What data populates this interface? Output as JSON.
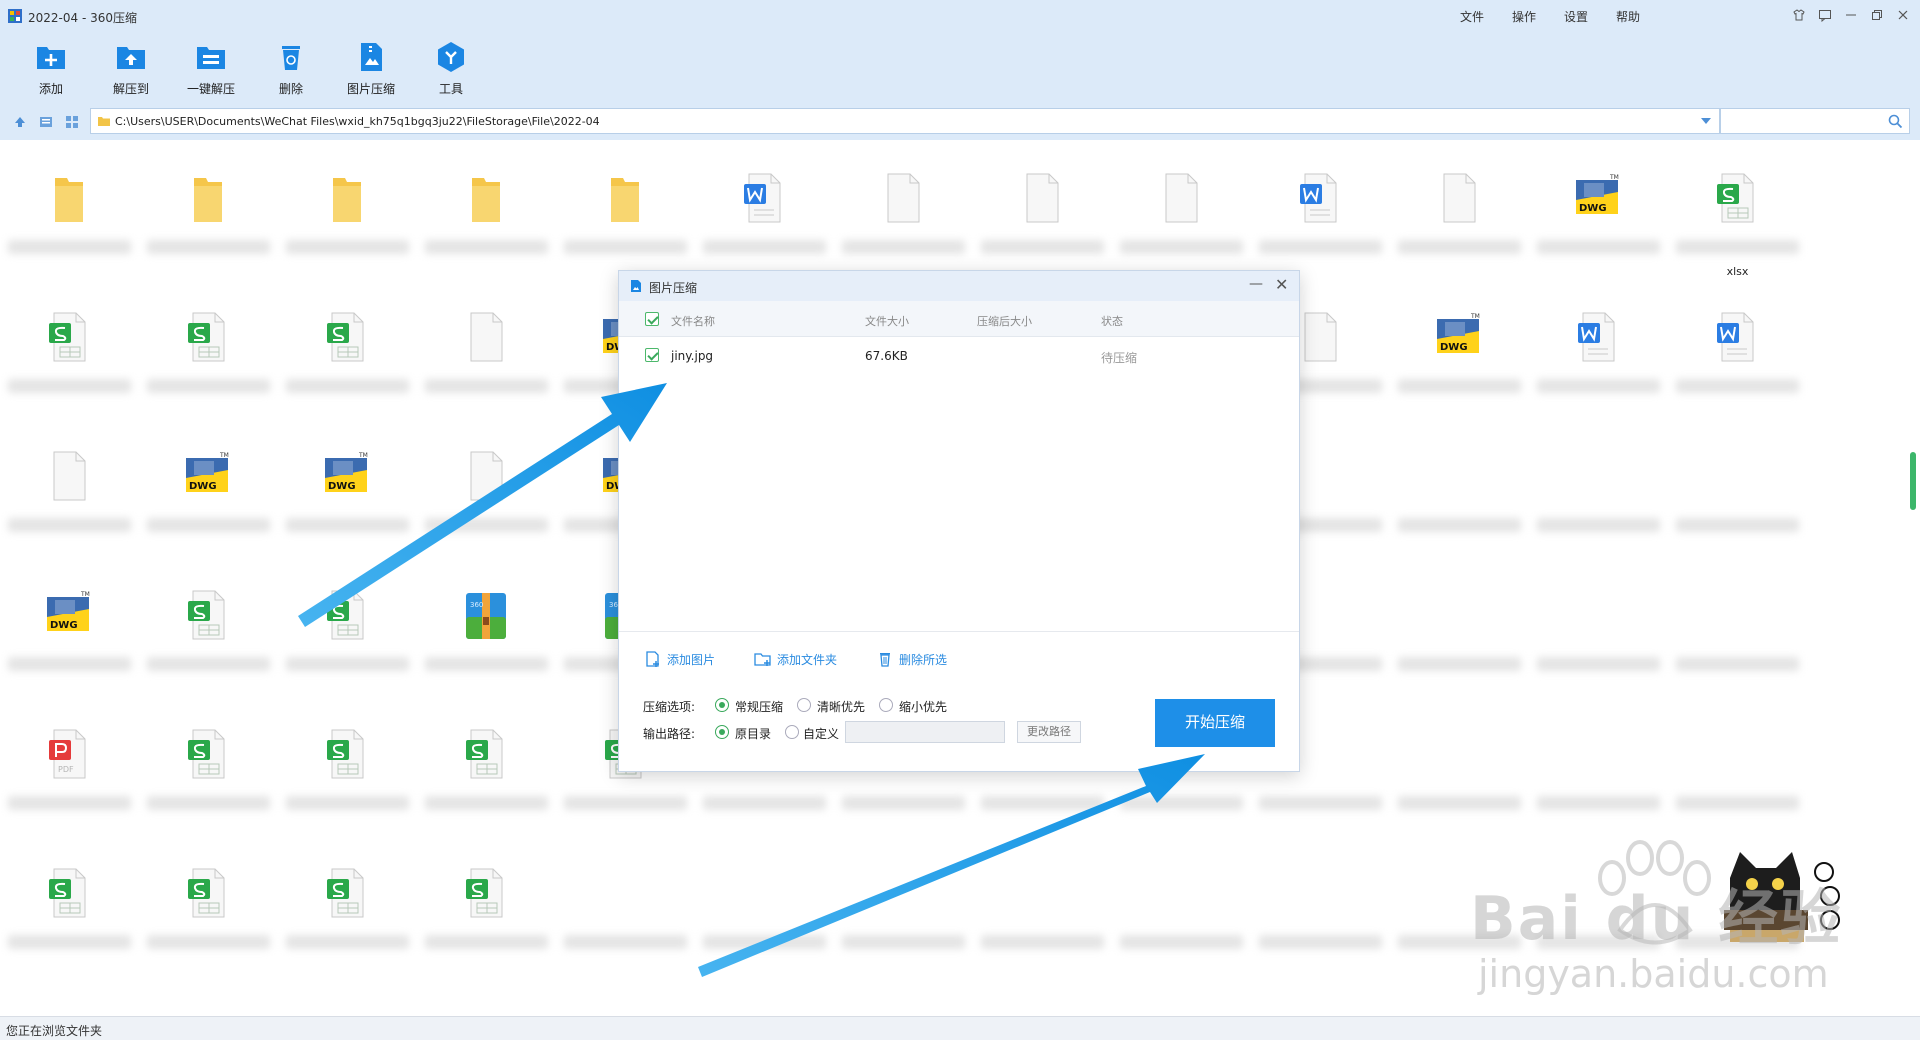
{
  "window": {
    "title": "2022-04 - 360压缩",
    "menu": [
      "文件",
      "操作",
      "设置",
      "帮助"
    ]
  },
  "toolbar": {
    "add": "添加",
    "extract_to": "解压到",
    "one_click_extract": "一键解压",
    "delete": "删除",
    "image_compress": "图片压缩",
    "tools": "工具"
  },
  "address": {
    "path": "C:\\Users\\USER\\Documents\\WeChat Files\\wxid_kh75q1bgq3ju22\\FileStorage\\File\\2022-04",
    "search_placeholder": ""
  },
  "grid": {
    "xlsx_label": "xlsx",
    "rows": [
      [
        "folder",
        "folder",
        "folder",
        "folder",
        "folder",
        "word",
        "blank",
        "blank",
        "blank",
        "word",
        "blank",
        "dwg",
        "excel"
      ],
      [
        "excel",
        "excel",
        "excel",
        "blank",
        "dwg",
        "",
        "",
        "",
        "",
        "blank",
        "dwg",
        "word",
        "word"
      ],
      [
        "blank",
        "dwg",
        "dwg",
        "blank",
        "dwg",
        "",
        "",
        "",
        "",
        "",
        "",
        "",
        ""
      ],
      [
        "dwg",
        "excel",
        "excel",
        "zip",
        "zip",
        "",
        "",
        "",
        "",
        "",
        "",
        "",
        ""
      ],
      [
        "pdf",
        "excel",
        "excel",
        "excel",
        "excel",
        "",
        "",
        "",
        "",
        "",
        "",
        "",
        ""
      ],
      [
        "excel",
        "excel",
        "excel",
        "excel",
        "",
        "",
        "",
        "",
        "",
        "",
        "",
        "",
        ""
      ]
    ]
  },
  "status": {
    "text": "您正在浏览文件夹"
  },
  "dialog": {
    "title": "图片压缩",
    "columns": {
      "name": "文件名称",
      "size": "文件大小",
      "compressed_size": "压缩后大小",
      "status": "状态"
    },
    "files": [
      {
        "name": "jiny.jpg",
        "size": "67.6KB",
        "compressed_size": "",
        "status": "待压缩"
      }
    ],
    "actions": {
      "add_image": "添加图片",
      "add_folder": "添加文件夹",
      "delete_selected": "删除所选"
    },
    "options": {
      "label": "压缩选项:",
      "normal": "常规压缩",
      "clarity": "清晰优先",
      "smaller": "缩小优先",
      "selected": "normal"
    },
    "output": {
      "label": "输出路径:",
      "original_dir": "原目录",
      "custom": "自定义",
      "change_path": "更改路径",
      "selected": "original_dir"
    },
    "start_button": "开始压缩"
  },
  "watermark": {
    "logo_text": "Bai du 经验",
    "url": "jingyan.baidu.com"
  },
  "colors": {
    "accent": "#1e8fe8",
    "arrow": "#1a9be6",
    "check_green": "#3aa95c",
    "chrome_bg": "#dceaf9"
  }
}
